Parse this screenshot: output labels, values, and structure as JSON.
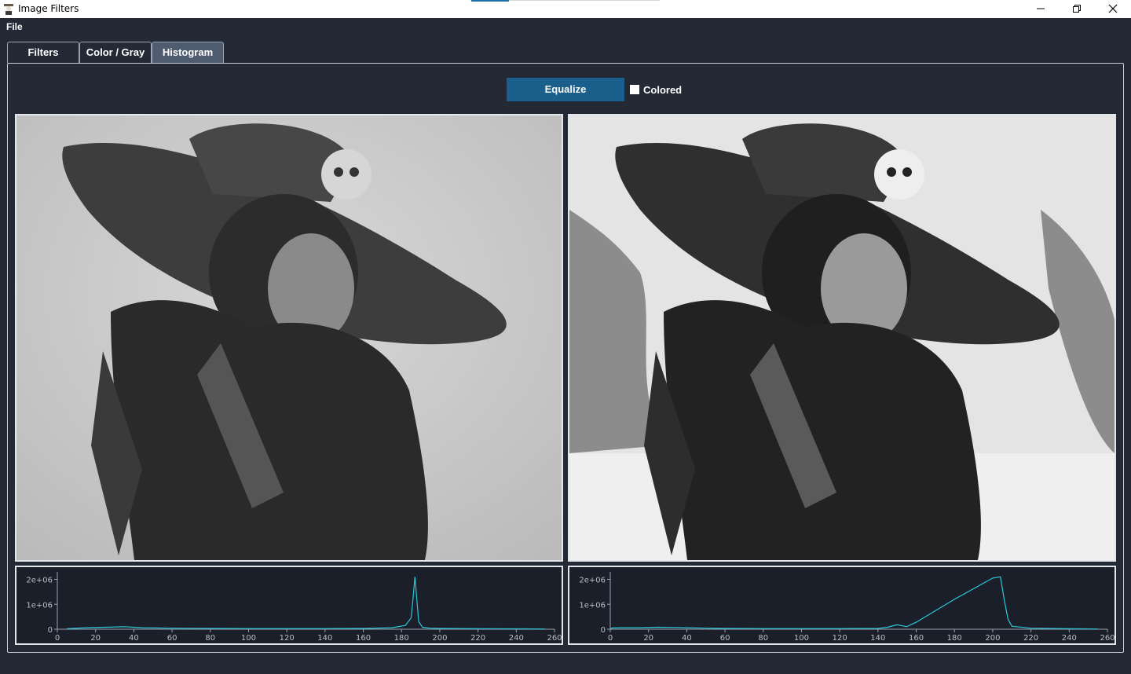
{
  "window": {
    "title": "Image Filters",
    "icon": "app-icon",
    "controls": [
      "minimize-icon",
      "maximize-icon",
      "close-icon"
    ]
  },
  "menu": {
    "file": "File"
  },
  "tabs": [
    {
      "label": "Filters",
      "active": false
    },
    {
      "label": "Color / Gray",
      "active": false
    },
    {
      "label": "Histogram",
      "active": true
    }
  ],
  "controls": {
    "equalize_label": "Equalize",
    "colored_label": "Colored",
    "colored_checked": false
  },
  "colors": {
    "accent": "#1b5f8c",
    "background": "#232a36",
    "plot_background": "#1b1f29",
    "histogram_line": "#28c8d8"
  },
  "images": {
    "original": "grayscale portrait",
    "equalized": "histogram-equalized grayscale portrait"
  },
  "chart_data": [
    {
      "type": "line",
      "x_ticks": [
        "0",
        "20",
        "40",
        "60",
        "80",
        "100",
        "120",
        "140",
        "160",
        "180",
        "200",
        "220",
        "240",
        "260"
      ],
      "y_ticks": [
        "2e+06",
        "1e+06",
        "0"
      ],
      "xlim": [
        0,
        260
      ],
      "ylim": [
        0,
        2300000
      ],
      "series": [
        {
          "x": [
            5,
            15,
            25,
            35,
            45,
            60,
            80,
            100,
            120,
            140,
            160,
            175,
            182,
            185,
            186,
            187,
            188,
            189,
            191,
            195,
            200,
            220,
            240,
            255
          ],
          "y": [
            20000,
            60000,
            80000,
            100000,
            60000,
            40000,
            30000,
            25000,
            25000,
            25000,
            30000,
            60000,
            150000,
            450000,
            1200000,
            2100000,
            1200000,
            300000,
            80000,
            40000,
            30000,
            20000,
            15000,
            10000
          ]
        }
      ]
    },
    {
      "type": "line",
      "x_ticks": [
        "0",
        "20",
        "40",
        "60",
        "80",
        "100",
        "120",
        "140",
        "160",
        "180",
        "200",
        "220",
        "240",
        "260"
      ],
      "y_ticks": [
        "2e+06",
        "1e+06",
        "0"
      ],
      "xlim": [
        0,
        260
      ],
      "ylim": [
        0,
        2300000
      ],
      "series": [
        {
          "x": [
            0,
            1,
            5,
            15,
            25,
            35,
            45,
            60,
            80,
            100,
            120,
            140,
            145,
            150,
            155,
            160,
            180,
            200,
            204,
            206,
            208,
            210,
            220,
            240,
            255
          ],
          "y": [
            10000,
            50000,
            60000,
            60000,
            80000,
            70000,
            50000,
            30000,
            25000,
            25000,
            25000,
            30000,
            80000,
            180000,
            100000,
            280000,
            1200000,
            2050000,
            2100000,
            1200000,
            400000,
            120000,
            40000,
            20000,
            10000
          ]
        }
      ]
    }
  ]
}
